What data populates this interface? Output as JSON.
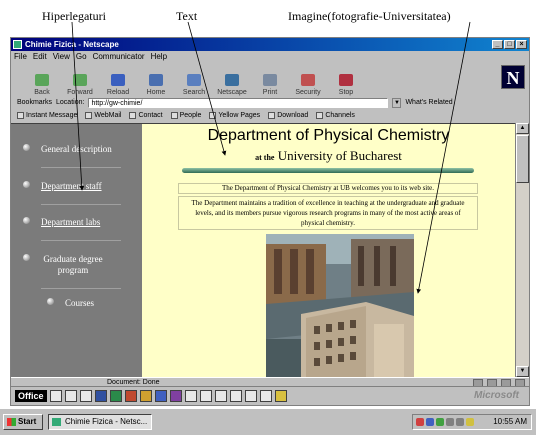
{
  "annotations": {
    "hyperlinks": "Hiperlegaturi",
    "text": "Text",
    "image": "Imagine(fotografie-Universitatea)"
  },
  "window": {
    "title": "Chimie Fizica - Netscape",
    "buttons": [
      "_",
      "□",
      "×"
    ]
  },
  "menu": [
    "File",
    "Edit",
    "View",
    "Go",
    "Communicator",
    "Help"
  ],
  "toolbar": [
    {
      "label": "Back",
      "icon": "back-arrow-icon"
    },
    {
      "label": "Forward",
      "icon": "forward-arrow-icon"
    },
    {
      "label": "Reload",
      "icon": "reload-icon"
    },
    {
      "label": "Home",
      "icon": "home-icon"
    },
    {
      "label": "Search",
      "icon": "search-icon"
    },
    {
      "label": "Netscape",
      "icon": "netscape-icon"
    },
    {
      "label": "Print",
      "icon": "print-icon"
    },
    {
      "label": "Security",
      "icon": "security-icon"
    },
    {
      "label": "Stop",
      "icon": "stop-icon"
    }
  ],
  "logo": "N",
  "location": {
    "bookmarks_label": "Bookmarks",
    "location_label": "Location:",
    "url": "http://gw-chimie/",
    "related_label": "What's Related"
  },
  "personal_toolbar": [
    "Instant Message",
    "WebMail",
    "Contact",
    "People",
    "Yellow Pages",
    "Download",
    "Channels"
  ],
  "sidebar": [
    {
      "label": "General description",
      "link": false
    },
    {
      "label": "Department staff",
      "link": true
    },
    {
      "label": "Department labs",
      "link": true
    },
    {
      "label": "Graduate degree program",
      "link": false
    },
    {
      "label": "Courses",
      "link": false
    }
  ],
  "page": {
    "title": "Department of Physical Chemistry",
    "subtitle_at": "at the",
    "subtitle": "University of Bucharest",
    "welcome": "The Department of Physical  Chemistry at UB welcomes  you to its web site.",
    "body": "The Department maintains a tradition of excellence in teaching at the undergraduate and graduate levels, and its members pursue vigorous research programs in many of the most active areas of physical chemistry."
  },
  "status": {
    "text": "Document: Done"
  },
  "office": {
    "label": "Office",
    "brand": "Microsoft"
  },
  "taskbar": {
    "start": "Start",
    "task": "Chimie Fizica - Netsc...",
    "clock": "10:55 AM"
  },
  "colors": {
    "sidebar_bg": "#7b7b7b",
    "page_bg": "#ffffc8",
    "title_bar": "#00007b"
  }
}
